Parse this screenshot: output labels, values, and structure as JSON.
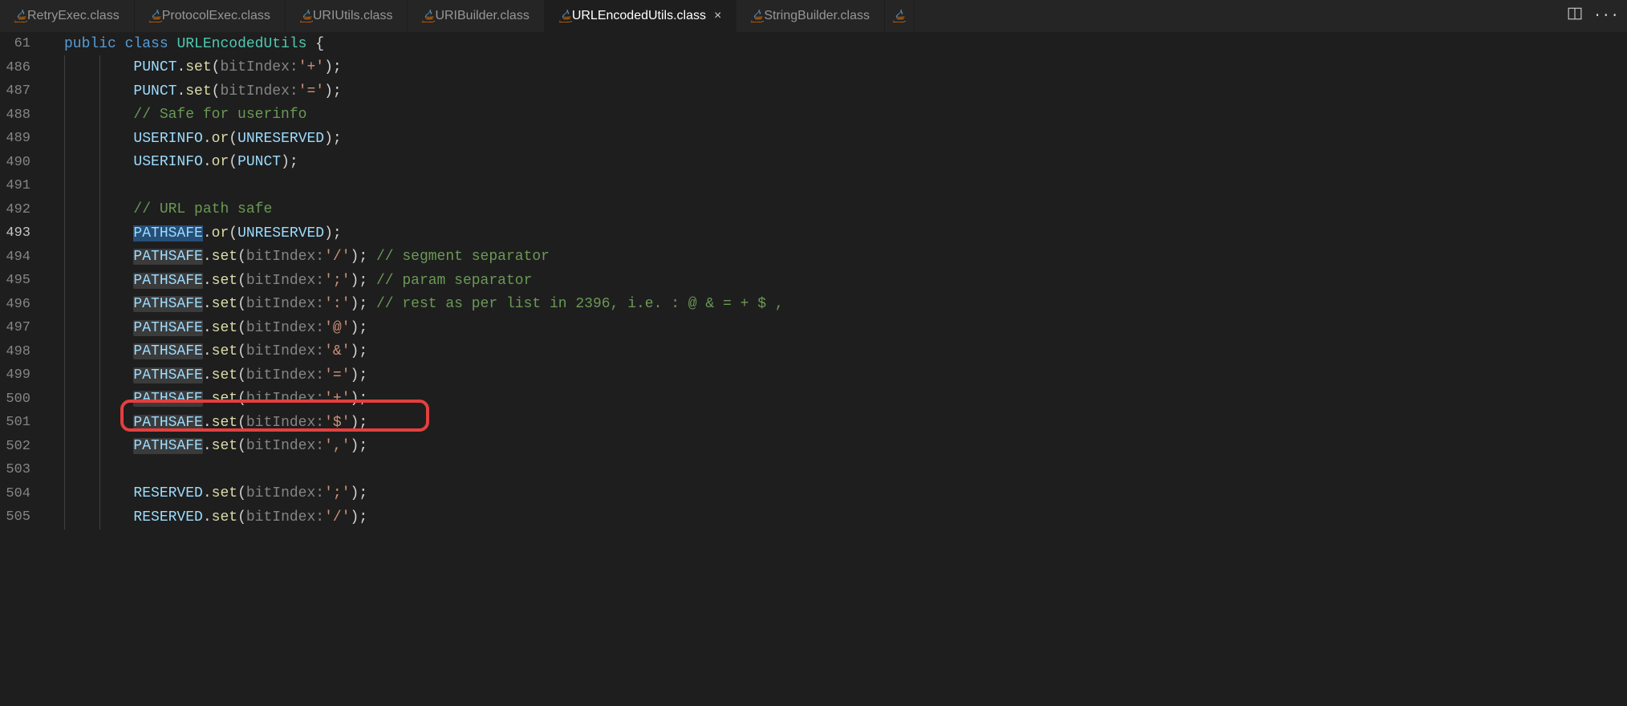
{
  "tabs": [
    {
      "label": "RetryExec.class",
      "active": false
    },
    {
      "label": "ProtocolExec.class",
      "active": false
    },
    {
      "label": "URIUtils.class",
      "active": false
    },
    {
      "label": "URIBuilder.class",
      "active": false
    },
    {
      "label": "URLEncodedUtils.class",
      "active": true
    },
    {
      "label": "StringBuilder.class",
      "active": false
    }
  ],
  "close_glyph": "×",
  "lines": {
    "l61": {
      "num": "61"
    },
    "l486": {
      "num": "486"
    },
    "l487": {
      "num": "487"
    },
    "l488": {
      "num": "488"
    },
    "l489": {
      "num": "489"
    },
    "l490": {
      "num": "490"
    },
    "l491": {
      "num": "491"
    },
    "l492": {
      "num": "492"
    },
    "l493": {
      "num": "493"
    },
    "l494": {
      "num": "494"
    },
    "l495": {
      "num": "495"
    },
    "l496": {
      "num": "496"
    },
    "l497": {
      "num": "497"
    },
    "l498": {
      "num": "498"
    },
    "l499": {
      "num": "499"
    },
    "l500": {
      "num": "500"
    },
    "l501": {
      "num": "501"
    },
    "l502": {
      "num": "502"
    },
    "l503": {
      "num": "503"
    },
    "l504": {
      "num": "504"
    },
    "l505": {
      "num": "505"
    }
  },
  "tokens": {
    "public": "public",
    "class": "class",
    "URLEncodedUtils": "URLEncodedUtils",
    "lbrace": "{",
    "PUNCT": "PUNCT",
    "USERINFO": "USERINFO",
    "PATHSAFE": "PATHSAFE",
    "RESERVED": "RESERVED",
    "UNRESERVED": "UNRESERVED",
    "set": "set",
    "or": "or",
    "bitIndex": "bitIndex:",
    "lparen": "(",
    "rparen": ")",
    "semi": ";",
    "dot": ".",
    "plus": "'+'",
    "eq": "'='",
    "slash": "'/'",
    "semicolon_ch": "';'",
    "colon_ch": "':'",
    "at": "'@'",
    "amp": "'&'",
    "dollar": "'$'",
    "comma": "','",
    "cmt_userinfo": "// Safe for userinfo",
    "cmt_pathsafe": "// URL path safe",
    "cmt_segment": "// segment separator",
    "cmt_param": "// param separator",
    "cmt_rest": "// rest as per list in 2396, i.e. : @ & = + $ ,"
  }
}
